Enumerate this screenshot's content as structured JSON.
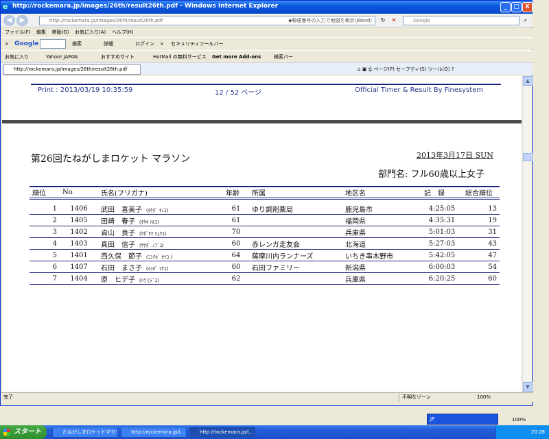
{
  "window": {
    "title": "http://rockemara.jp/images/26th/result26th.pdf - Windows Internet Explorer",
    "url": "http://rockemara.jp/images/26th/result26th.pdf",
    "url_hint": "◆郵便番号の入力で地図を表示(JWord)",
    "search_placeholder": "Google",
    "buttons": {
      "minimize": "_",
      "maximize": "□",
      "close": "X"
    }
  },
  "menu": [
    "ファイル(F)",
    "編集",
    "移動(G)",
    "お気に入り(A)",
    "ヘルプ(H)"
  ],
  "google_bar": {
    "close": "×",
    "logo": "Google",
    "search": "検索",
    "details": "詳細",
    "login": "ログイン",
    "security": "セキュリティツールバー"
  },
  "favorites": [
    "お気に入り",
    "Yahoo! JAPAN",
    "おすすめサイト",
    "HotMail の無料サービス",
    "Get more Add-ons",
    "検索バー"
  ],
  "tab": {
    "label": "http://rockemara.jp/images/26th/result26th.pdf",
    "tools": [
      "ページ(P)",
      "セーフティ(S)",
      "ツール(O)"
    ]
  },
  "doc_header": {
    "printed": "Print : 2013/03/19 10:35:59",
    "page": "12 / 52 ページ",
    "system": "Official Timer & Result By Finesystem"
  },
  "race": {
    "title": "第26回たねがしまロケット マラソン",
    "date": "2013年3月17日 SUN",
    "division": "部門名: フル60歳以上女子"
  },
  "table": {
    "headers": {
      "rank": "順位",
      "no": "No",
      "name": "氏名(フリガナ)",
      "age": "年齢",
      "affiliation": "所属",
      "region": "地区名",
      "time": "記　録",
      "overall": "総合順位"
    },
    "rows": [
      {
        "rank": "1",
        "no": "1406",
        "name": "武田　喜美子",
        "kana": "(ﾀｹﾀﾞ ｷﾐｺ)",
        "age": "61",
        "affiliation": "ゆり調剤薬局",
        "region": "鹿児島市",
        "time": "4:25:05",
        "overall": "13"
      },
      {
        "rank": "2",
        "no": "1405",
        "name": "田崎　春子",
        "kana": "(ﾀｻｷ ﾊﾙｺ)",
        "age": "61",
        "affiliation": "",
        "region": "福岡県",
        "time": "4:35:31",
        "overall": "19"
      },
      {
        "rank": "3",
        "no": "1402",
        "name": "貞山　良子",
        "kana": "(ｻﾀﾞﾔﾏ ﾘｮｳｺ)",
        "age": "70",
        "affiliation": "",
        "region": "兵庫県",
        "time": "5:01:03",
        "overall": "31"
      },
      {
        "rank": "4",
        "no": "1403",
        "name": "真田　信子",
        "kana": "(ｻﾅﾀﾞ ﾉﾌﾞｺ)",
        "age": "60",
        "affiliation": "赤レンガ走友会",
        "region": "北海道",
        "time": "5:27:03",
        "overall": "43"
      },
      {
        "rank": "5",
        "no": "1401",
        "name": "西久保　節子",
        "kana": "(ﾆｼｸﾎﾞ ｾﾂｺ )",
        "age": "64",
        "affiliation": "薩摩川内ランナーズ",
        "region": "いちき串木野市",
        "time": "5:42:05",
        "overall": "47"
      },
      {
        "rank": "6",
        "no": "1407",
        "name": "石田　まさ子",
        "kana": "(ｲｼﾀﾞ ﾏｻｺ)",
        "age": "60",
        "affiliation": "石田ファミリー",
        "region": "新潟県",
        "time": "6:00:03",
        "overall": "54"
      },
      {
        "rank": "7",
        "no": "1404",
        "name": "原　ヒデ子",
        "kana": "(ﾊﾗ ﾋﾃﾞｺ)",
        "age": "62",
        "affiliation": "",
        "region": "兵庫県",
        "time": "6:20:25",
        "overall": "60"
      }
    ]
  },
  "status": {
    "text": "完了",
    "zone": "不明なゾーン",
    "zoom": "100%"
  },
  "taskbar": {
    "start": "スタート",
    "tasks": [
      "たねがしまロケットマラソ...",
      "http://rockemara.jp/i...",
      "http://rockemara.jp/i..."
    ],
    "clock": "20:28",
    "ime": "JP"
  }
}
